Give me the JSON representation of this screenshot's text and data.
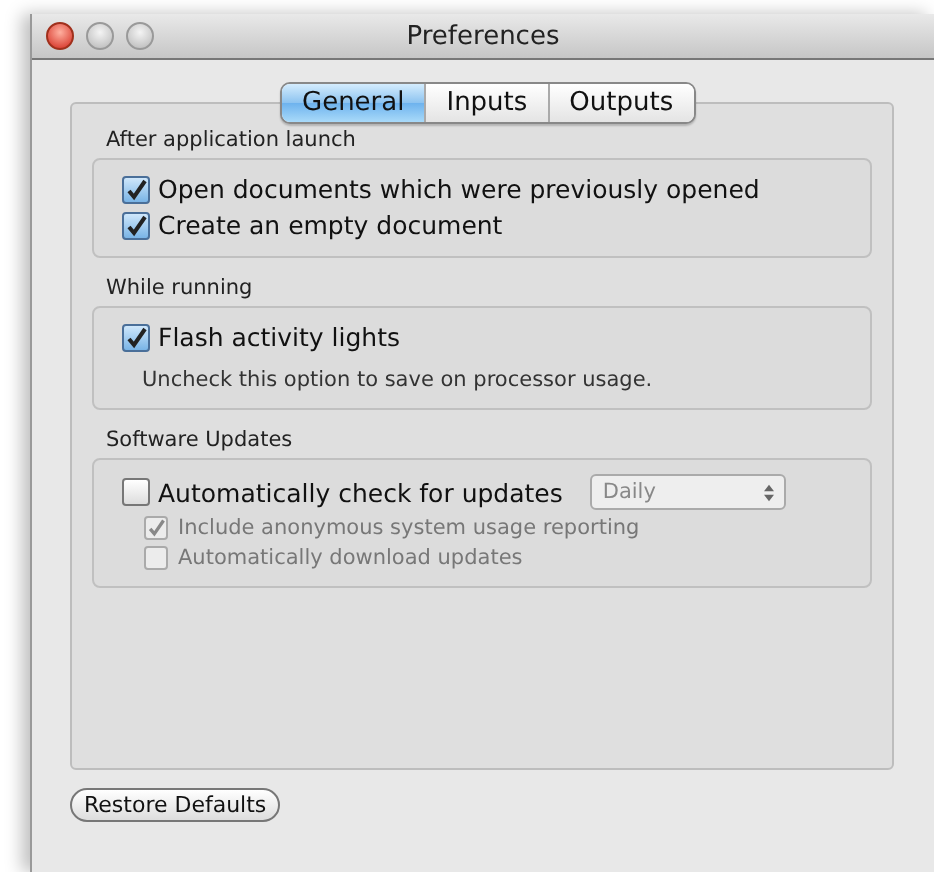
{
  "window": {
    "title": "Preferences"
  },
  "tabs": [
    {
      "label": "General",
      "selected": true
    },
    {
      "label": "Inputs",
      "selected": false
    },
    {
      "label": "Outputs",
      "selected": false
    }
  ],
  "sections": [
    {
      "title": "After application launch",
      "items": [
        {
          "kind": "checkbox",
          "label": "Open documents which were previously opened",
          "checked": true,
          "disabled": false
        },
        {
          "kind": "checkbox",
          "label": "Create an empty document",
          "checked": true,
          "disabled": false
        }
      ]
    },
    {
      "title": "While running",
      "items": [
        {
          "kind": "checkbox",
          "label": "Flash activity lights",
          "checked": true,
          "disabled": false
        },
        {
          "kind": "note",
          "text": "Uncheck this option to save on processor usage."
        }
      ]
    },
    {
      "title": "Software Updates",
      "items": [
        {
          "kind": "checkbox",
          "label": "Automatically check for updates",
          "checked": false,
          "disabled": false,
          "select": {
            "value": "Daily",
            "disabled": true
          }
        },
        {
          "kind": "subcheckbox",
          "label": "Include anonymous system usage reporting",
          "checked": true,
          "disabled": true
        },
        {
          "kind": "subcheckbox",
          "label": "Automatically download updates",
          "checked": false,
          "disabled": true
        }
      ]
    }
  ],
  "buttons": [
    {
      "label": "Restore Defaults"
    }
  ]
}
